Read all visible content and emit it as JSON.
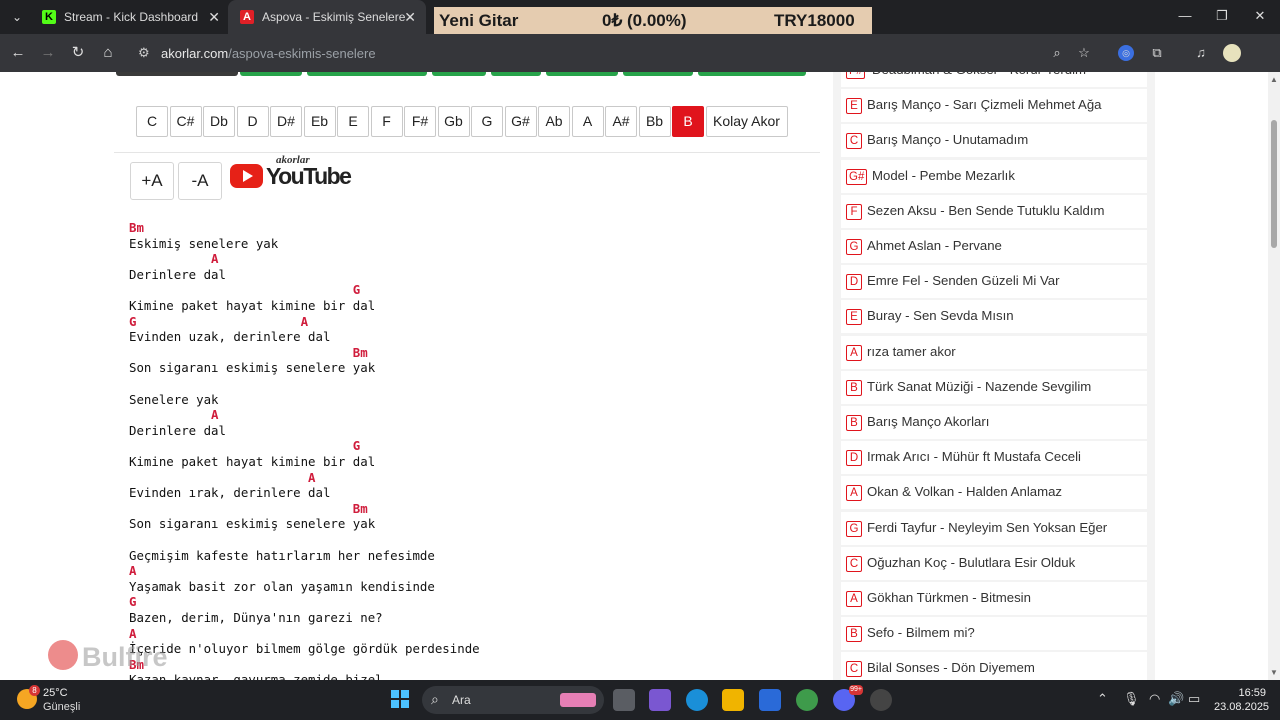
{
  "browser": {
    "tabs": [
      {
        "title": "Stream - Kick Dashboard",
        "favicon": "K",
        "active": false
      },
      {
        "title": "Aspova - Eskimiş Senelere - Akor",
        "favicon": "A",
        "active": true
      }
    ],
    "ticker": {
      "name": "Yeni Gitar",
      "change": "0₺ (0.00%)",
      "price": "TRY18000"
    },
    "url_host": "akorlar.com",
    "url_path": "/aspova-eskimis-senelere"
  },
  "keys": {
    "items": [
      "C",
      "C#",
      "Db",
      "D",
      "D#",
      "Eb",
      "E",
      "F",
      "F#",
      "Gb",
      "G",
      "G#",
      "Ab",
      "A",
      "A#",
      "Bb",
      "B"
    ],
    "selected": "B",
    "easy_label": "Kolay Akor"
  },
  "font_controls": {
    "increase": "+A",
    "decrease": "-A"
  },
  "youtube": {
    "brand": "akorlar",
    "label": "YouTube"
  },
  "song": {
    "lines": [
      {
        "type": "chord",
        "text": "Bm"
      },
      {
        "type": "lyric",
        "text": "Eskimiş senelere yak"
      },
      {
        "type": "chord",
        "text": "           A"
      },
      {
        "type": "lyric",
        "text": "Derinlere dal"
      },
      {
        "type": "chord",
        "text": "                              G"
      },
      {
        "type": "lyric",
        "text": "Kimine paket hayat kimine bir dal"
      },
      {
        "type": "chord",
        "text": "G                      A"
      },
      {
        "type": "lyric",
        "text": "Evinden uzak, derinlere dal"
      },
      {
        "type": "chord",
        "text": "                              Bm"
      },
      {
        "type": "lyric",
        "text": "Son sigaranı eskimiş senelere yak"
      },
      {
        "type": "blank",
        "text": ""
      },
      {
        "type": "lyric",
        "text": "Senelere yak"
      },
      {
        "type": "chord",
        "text": "           A"
      },
      {
        "type": "lyric",
        "text": "Derinlere dal"
      },
      {
        "type": "chord",
        "text": "                              G"
      },
      {
        "type": "lyric",
        "text": "Kimine paket hayat kimine bir dal"
      },
      {
        "type": "chord",
        "text": "                        A"
      },
      {
        "type": "lyric",
        "text": "Evinden ırak, derinlere dal"
      },
      {
        "type": "chord",
        "text": "                              Bm"
      },
      {
        "type": "lyric",
        "text": "Son sigaranı eskimiş senelere yak"
      },
      {
        "type": "blank",
        "text": ""
      },
      {
        "type": "lyric",
        "text": "Geçmişim kafeste hatırlarım her nefesimde"
      },
      {
        "type": "chord",
        "text": "A"
      },
      {
        "type": "lyric",
        "text": "Yaşamak basit zor olan yaşamın kendisinde"
      },
      {
        "type": "chord",
        "text": "G"
      },
      {
        "type": "lyric",
        "text": "Bazen, derim, Dünya'nın garezi ne?"
      },
      {
        "type": "chord",
        "text": "A"
      },
      {
        "type": "lyric",
        "text": "İçeride n'oluyor bilmem gölge gördük perdesinde"
      },
      {
        "type": "chord",
        "text": "Bm"
      },
      {
        "type": "lyric",
        "text": "Kazan kaynar, gavurma zemide bizel"
      }
    ]
  },
  "watermark": {
    "text": "Bulfire"
  },
  "sidebar": {
    "items": [
      {
        "key": "F#",
        "title": "Deadbiman & Gökser - Korur Yerdim"
      },
      {
        "key": "E",
        "title": "Barış Manço - Sarı Çizmeli Mehmet Ağa"
      },
      {
        "key": "C",
        "title": "Barış Manço - Unutamadım"
      },
      {
        "key": "G#",
        "title": "Model - Pembe Mezarlık"
      },
      {
        "key": "F",
        "title": "Sezen Aksu - Ben Sende Tutuklu Kaldım"
      },
      {
        "key": "G",
        "title": "Ahmet Aslan - Pervane"
      },
      {
        "key": "D",
        "title": "Emre Fel - Senden Güzeli Mi Var"
      },
      {
        "key": "E",
        "title": "Buray - Sen Sevda Mısın"
      },
      {
        "key": "A",
        "title": "rıza tamer akor"
      },
      {
        "key": "B",
        "title": "Türk Sanat Müziği - Nazende Sevgilim"
      },
      {
        "key": "B",
        "title": "Barış Manço Akorları"
      },
      {
        "key": "D",
        "title": "Irmak Arıcı - Mühür ft Mustafa Ceceli"
      },
      {
        "key": "A",
        "title": "Okan & Volkan - Halden Anlamaz"
      },
      {
        "key": "G",
        "title": "Ferdi Tayfur - Neyleyim Sen Yoksan Eğer"
      },
      {
        "key": "C",
        "title": "Oğuzhan Koç - Bulutlara Esir Olduk"
      },
      {
        "key": "A",
        "title": "Gökhan Türkmen - Bitmesin"
      },
      {
        "key": "B",
        "title": "Sefo - Bilmem mi?"
      },
      {
        "key": "C",
        "title": "Bilal Sonses - Dön Diyemem"
      }
    ]
  },
  "taskbar": {
    "weather_temp": "25°C",
    "weather_desc": "Güneşli",
    "weather_badge": "8",
    "search_placeholder": "Ara",
    "discord_badge": "99+",
    "time": "16:59",
    "date": "23.08.2025"
  }
}
